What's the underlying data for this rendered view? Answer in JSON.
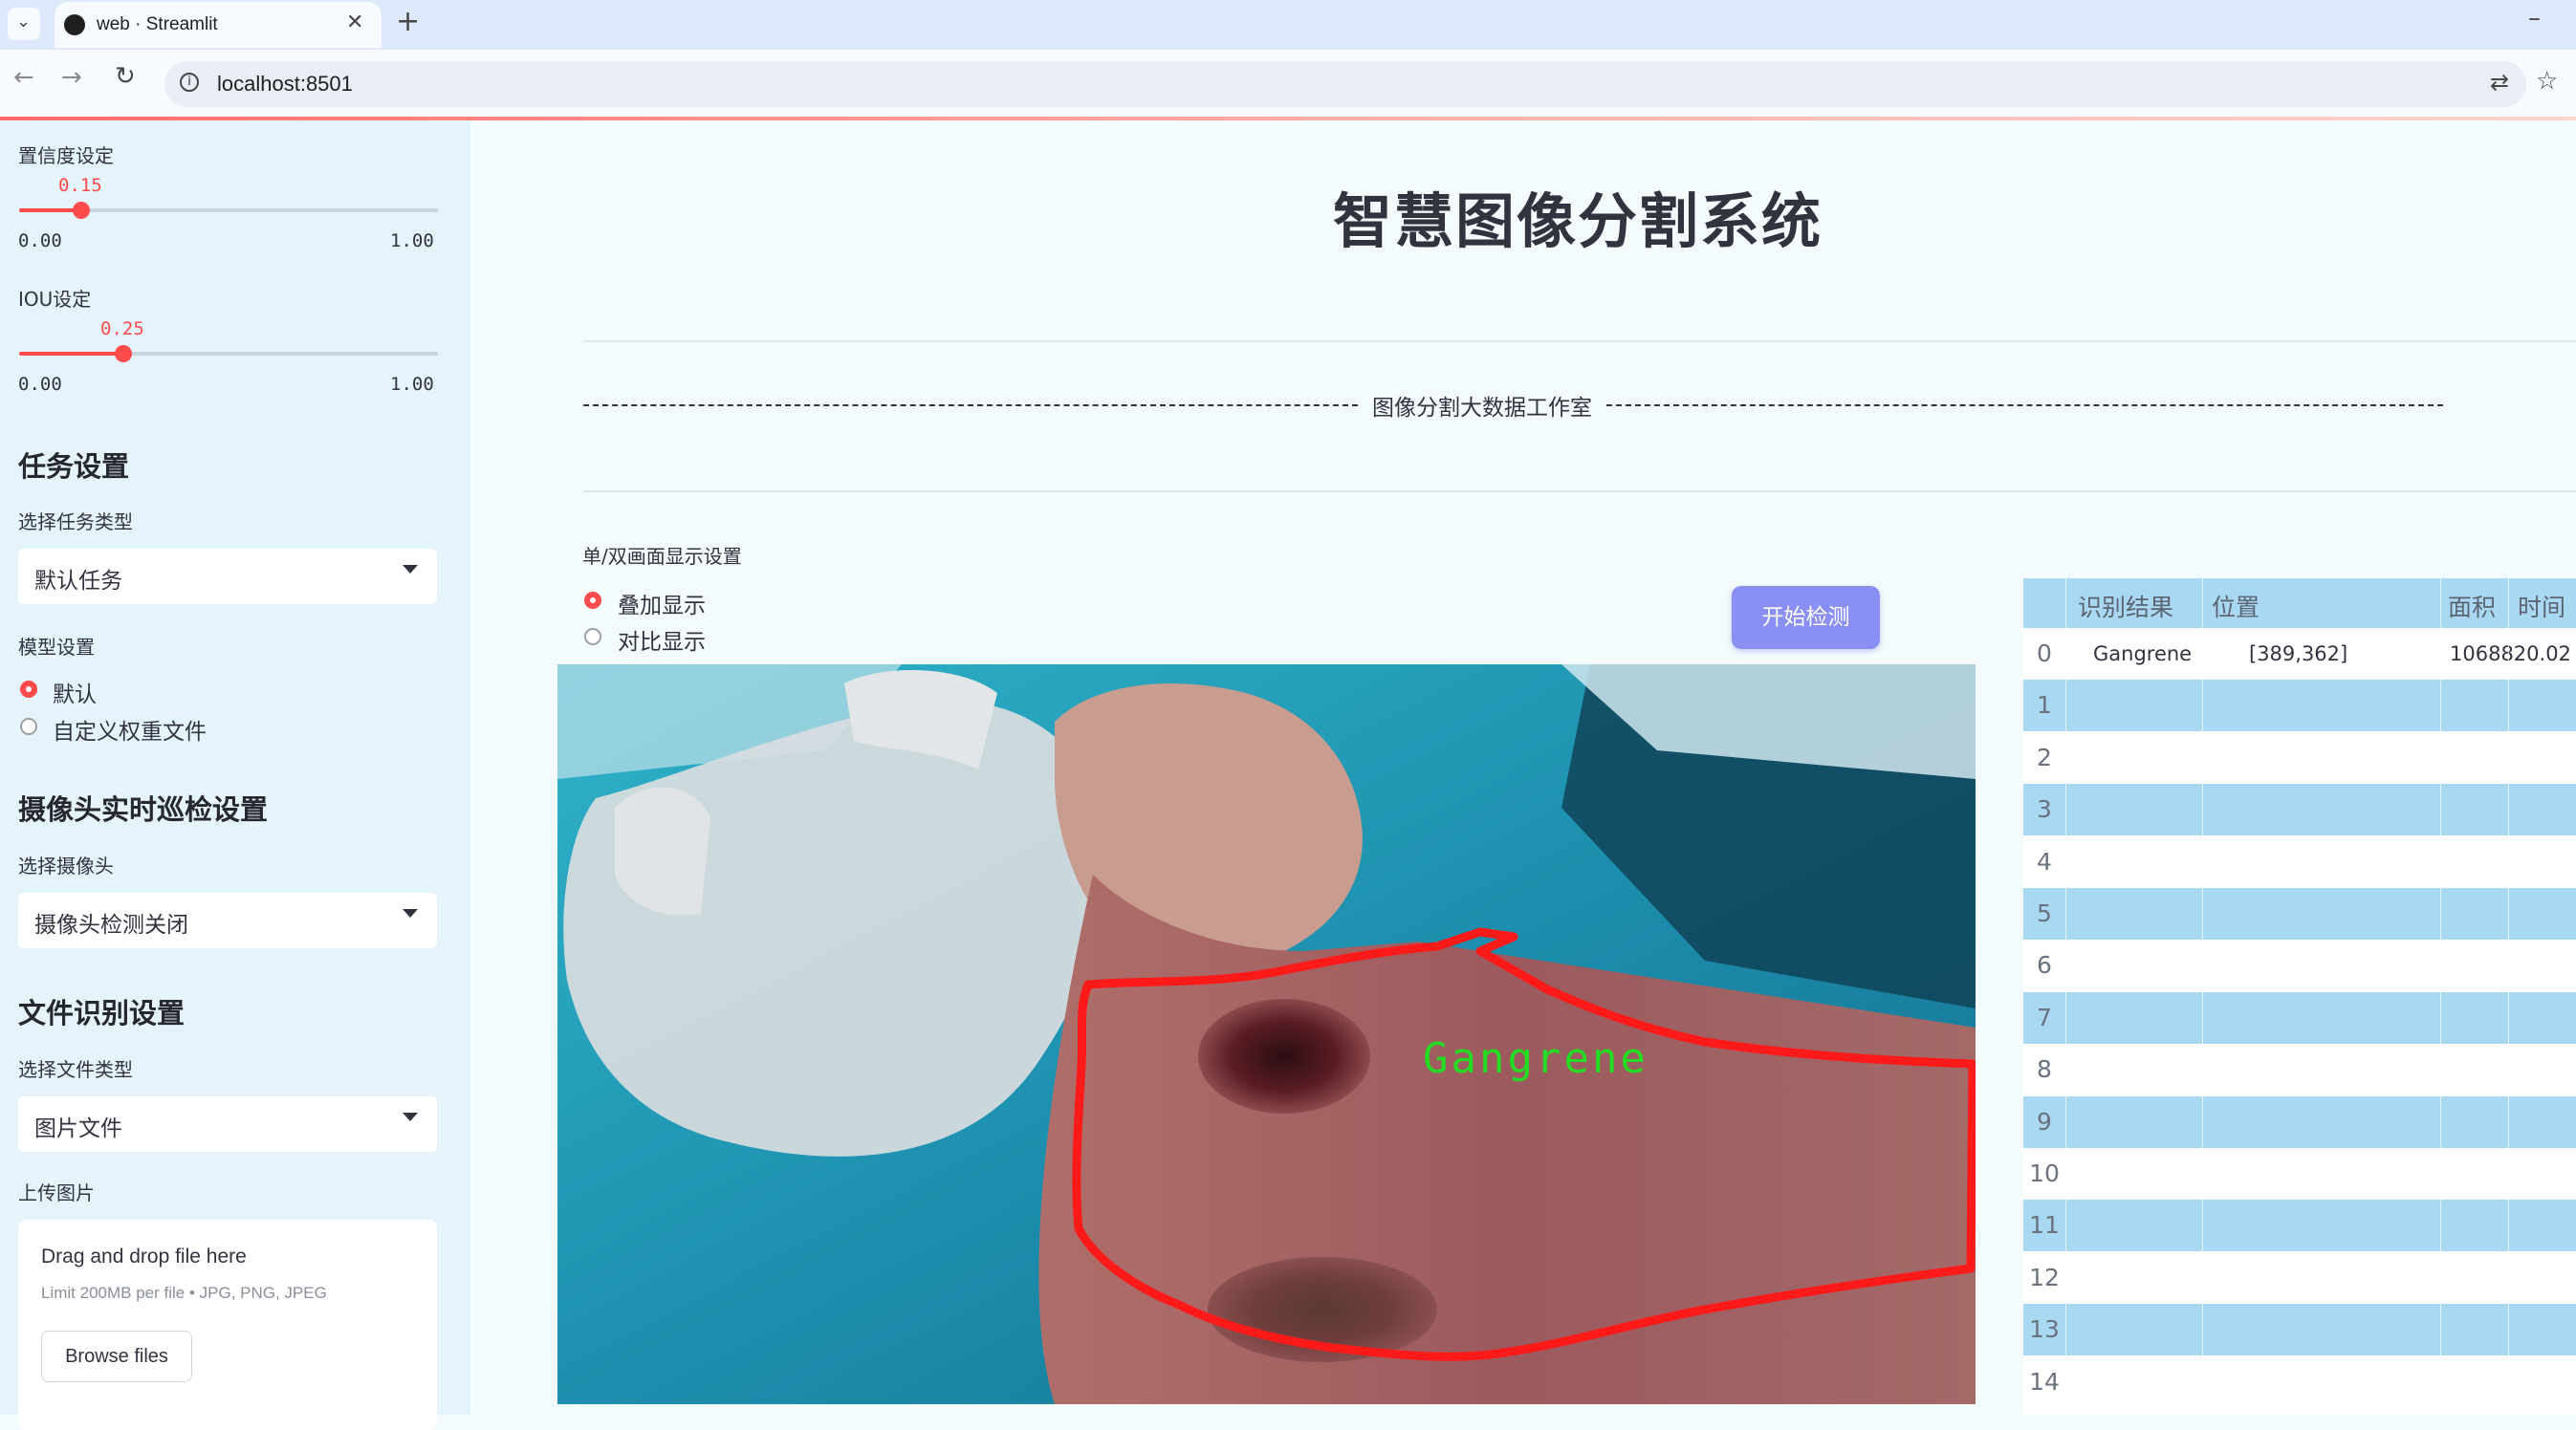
{
  "browser": {
    "tab_title": "web · Streamlit",
    "url": "localhost:8501"
  },
  "sidebar": {
    "confidence": {
      "label": "置信度设定",
      "value": "0.15",
      "value_fraction": 0.15,
      "min": "0.00",
      "max": "1.00"
    },
    "iou": {
      "label": "IOU设定",
      "value": "0.25",
      "value_fraction": 0.25,
      "min": "0.00",
      "max": "1.00"
    },
    "task_heading": "任务设置",
    "task_type_label": "选择任务类型",
    "task_type_value": "默认任务",
    "model_label": "模型设置",
    "model_options": [
      "默认",
      "自定义权重文件"
    ],
    "model_selected": "默认",
    "camera_heading": "摄像头实时巡检设置",
    "camera_label": "选择摄像头",
    "camera_value": "摄像头检测关闭",
    "file_heading": "文件识别设置",
    "file_type_label": "选择文件类型",
    "file_type_value": "图片文件",
    "upload_label": "上传图片",
    "upload_drag_text": "Drag and drop file here",
    "upload_limit_text": "Limit 200MB per file • JPG, PNG, JPEG",
    "browse_button": "Browse files"
  },
  "main": {
    "title": "智慧图像分割系统",
    "studio_text": "图像分割大数据工作室",
    "display_mode_label": "单/双画面显示设置",
    "display_options": [
      "叠加显示",
      "对比显示"
    ],
    "display_selected": "叠加显示",
    "start_button": "开始检测",
    "detection_label": "Gangrene"
  },
  "table": {
    "columns": [
      "识别结果",
      "位置",
      "面积",
      "时间"
    ],
    "row_indices": [
      "0",
      "1",
      "2",
      "3",
      "4",
      "5",
      "6",
      "7",
      "8",
      "9",
      "10",
      "11",
      "12",
      "13",
      "14"
    ],
    "rows": [
      {
        "result": "Gangrene",
        "position": "[389,362]",
        "area": "1068820.02",
        "time": ""
      }
    ]
  },
  "colors": {
    "accent": "#ff4b4b",
    "button": "#8a8ff5",
    "table_stripe": "#a9d8f3",
    "mask_outline": "#ff1a1a",
    "label_text": "#22dd22"
  }
}
